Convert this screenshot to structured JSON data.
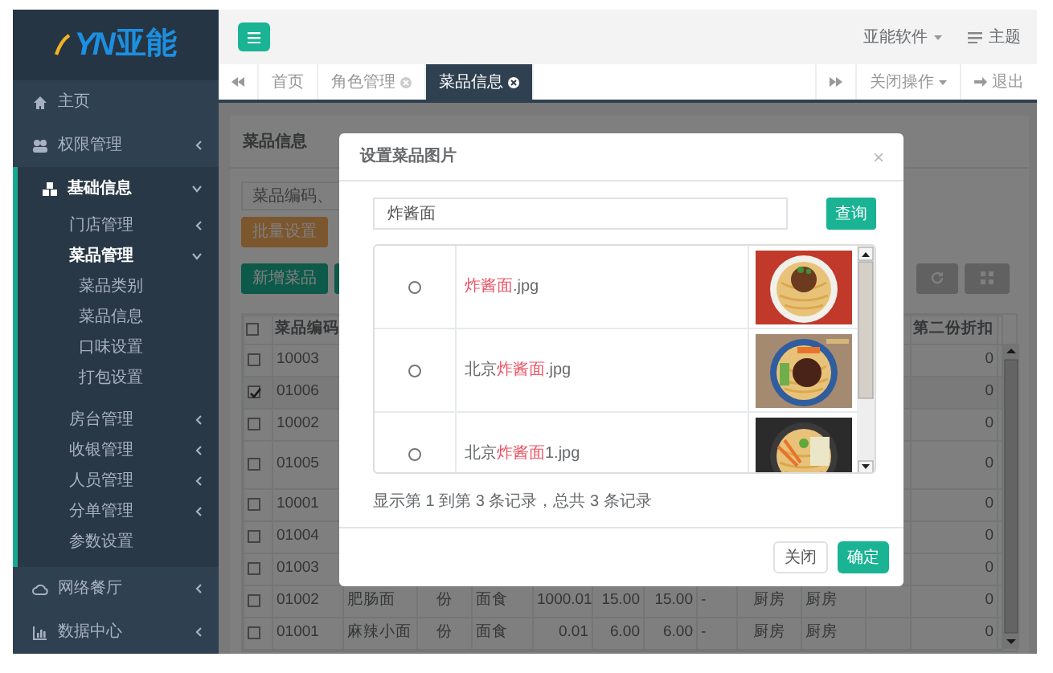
{
  "sidebar": {
    "logo": {
      "mark": "YN",
      "name": "亚能"
    },
    "items": [
      {
        "label": "主页",
        "selected": false
      },
      {
        "label": "权限管理",
        "selected": false,
        "expanded": false
      },
      {
        "label": "基础信息",
        "selected": true,
        "expanded": true,
        "children": [
          {
            "label": "门店管理",
            "selected": false,
            "expanded": false
          },
          {
            "label": "菜品管理",
            "selected": false,
            "expanded": true,
            "children": [
              {
                "label": "菜品类别",
                "selected": false
              },
              {
                "label": "菜品信息",
                "selected": false
              },
              {
                "label": "口味设置",
                "selected": false
              },
              {
                "label": "打包设置",
                "selected": false
              }
            ]
          },
          {
            "label": "房台管理",
            "selected": false,
            "expanded": false
          },
          {
            "label": "收银管理",
            "selected": false,
            "expanded": false
          },
          {
            "label": "人员管理",
            "selected": false,
            "expanded": false
          },
          {
            "label": "分单管理",
            "selected": false,
            "expanded": false
          },
          {
            "label": "参数设置",
            "selected": false
          }
        ]
      },
      {
        "label": "网络餐厅",
        "selected": false,
        "expanded": false
      },
      {
        "label": "数据中心",
        "selected": false,
        "expanded": false
      }
    ]
  },
  "header": {
    "user_menu": "亚能软件",
    "theme": "主题"
  },
  "tabs": {
    "items": [
      {
        "label": "首页",
        "closable": false,
        "selected": false
      },
      {
        "label": "角色管理",
        "closable": true,
        "selected": false
      },
      {
        "label": "菜品信息",
        "closable": true,
        "selected": true
      }
    ],
    "close_menu": "关闭操作",
    "logout": "退出"
  },
  "panel": {
    "title": "菜品信息",
    "search_placeholder": "菜品编码、",
    "batch_button": "批量设置",
    "add_button": "新增菜品",
    "table": {
      "header_checked": false,
      "code_header": "菜品编码",
      "discount_header": "第二份折扣",
      "rows": [
        {
          "code": "10003",
          "checked": false,
          "discount": "0"
        },
        {
          "code": "01006",
          "checked": true,
          "discount": "0"
        },
        {
          "code": "10002",
          "checked": false,
          "discount": "0"
        },
        {
          "code": "01005",
          "checked": false,
          "discount": "0",
          "tall": true
        },
        {
          "code": "10001",
          "checked": false,
          "discount": "0"
        },
        {
          "code": "01004",
          "checked": false,
          "discount": "0"
        },
        {
          "code": "01003",
          "checked": false,
          "discount": "0"
        },
        {
          "code": "01002",
          "checked": false,
          "discount": "0",
          "cells": [
            "肥肠面",
            "份",
            "面食",
            "1000.01",
            "15.00",
            "15.00",
            "-",
            "厨房",
            "厨房"
          ]
        },
        {
          "code": "01001",
          "checked": false,
          "discount": "0",
          "cells": [
            "麻辣小面",
            "份",
            "面食",
            "0.01",
            "6.00",
            "6.00",
            "-",
            "厨房",
            "厨房"
          ]
        }
      ]
    }
  },
  "modal": {
    "title": "设置菜品图片",
    "close_glyph": "×",
    "search_value": "炸酱面",
    "search_button": "查询",
    "rows": [
      {
        "selected": false,
        "filename": [
          {
            "text": "炸酱面",
            "highlight": true
          },
          {
            "text": ".jpg",
            "highlight": false
          }
        ]
      },
      {
        "selected": false,
        "filename": [
          {
            "text": "北京",
            "highlight": false
          },
          {
            "text": "炸酱面",
            "highlight": true
          },
          {
            "text": ".jpg",
            "highlight": false
          }
        ]
      },
      {
        "selected": false,
        "filename": [
          {
            "text": "北京",
            "highlight": false
          },
          {
            "text": "炸酱面",
            "highlight": true
          },
          {
            "text": "1.jpg",
            "highlight": false
          }
        ]
      }
    ],
    "summary": "显示第 1 到第 3 条记录，总共 3 条记录",
    "buttons": [
      {
        "label": "关闭",
        "primary": false
      },
      {
        "label": "确定",
        "primary": true
      }
    ]
  }
}
